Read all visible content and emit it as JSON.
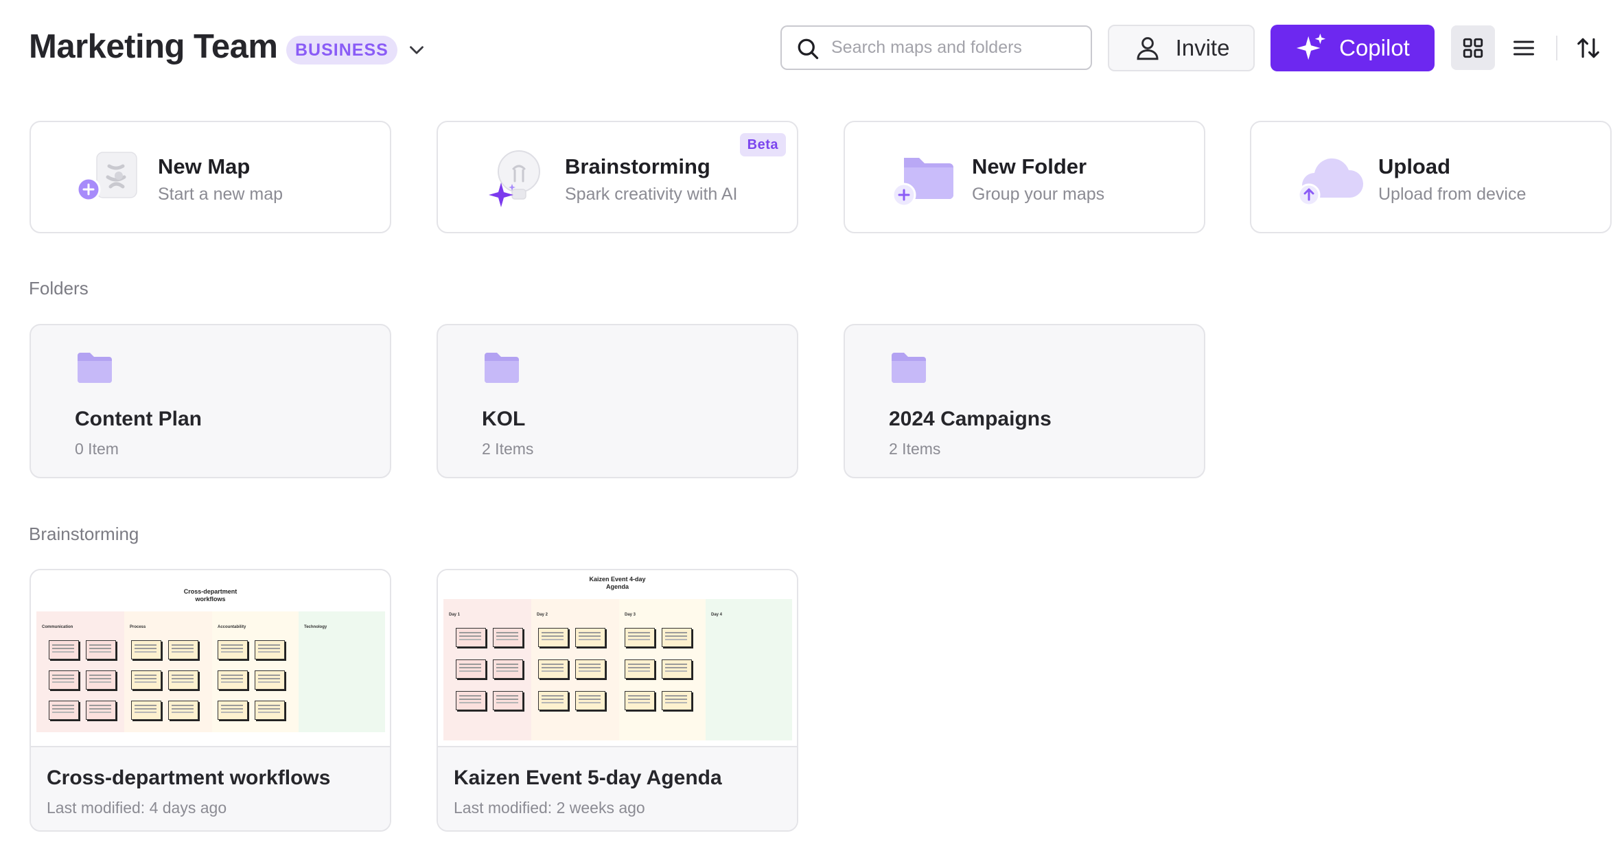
{
  "header": {
    "team_name": "Marketing Team",
    "plan_badge": "BUSINESS",
    "search_placeholder": "Search maps and folders",
    "invite_label": "Invite",
    "copilot_label": "Copilot"
  },
  "colors": {
    "accent": "#6d28f0",
    "badge_bg": "#e8e1fb",
    "badge_text": "#8a5cf6",
    "folder": "#c4b5fd"
  },
  "quick_actions": [
    {
      "title": "New Map",
      "subtitle": "Start a new map",
      "icon": "new-map-icon"
    },
    {
      "title": "Brainstorming",
      "subtitle": "Spark creativity with AI",
      "badge": "Beta",
      "icon": "lightbulb-sparkle-icon"
    },
    {
      "title": "New Folder",
      "subtitle": "Group your maps",
      "icon": "folder-plus-icon"
    },
    {
      "title": "Upload",
      "subtitle": "Upload from device",
      "icon": "cloud-upload-icon"
    }
  ],
  "sections": {
    "folders": "Folders",
    "brainstorming": "Brainstorming"
  },
  "folders": [
    {
      "name": "Content Plan",
      "count": "0 Item"
    },
    {
      "name": "KOL",
      "count": "2 Items"
    },
    {
      "name": "2024 Campaigns",
      "count": "2 Items"
    }
  ],
  "maps": [
    {
      "name": "Cross-department workflows",
      "modified": "Last modified: 4 days ago",
      "thumb_title_line1": "Cross-department",
      "thumb_title_line2": "workflows",
      "lanes": [
        "Communication",
        "Process",
        "Accountability",
        "Technology"
      ]
    },
    {
      "name": "Kaizen Event 5-day Agenda",
      "modified": "Last modified: 2 weeks ago",
      "thumb_title_line1": "Kaizen Event 4-day",
      "thumb_title_line2": "Agenda",
      "lanes": [
        "Day 1",
        "Day 2",
        "Day 3",
        "Day 4"
      ]
    }
  ]
}
